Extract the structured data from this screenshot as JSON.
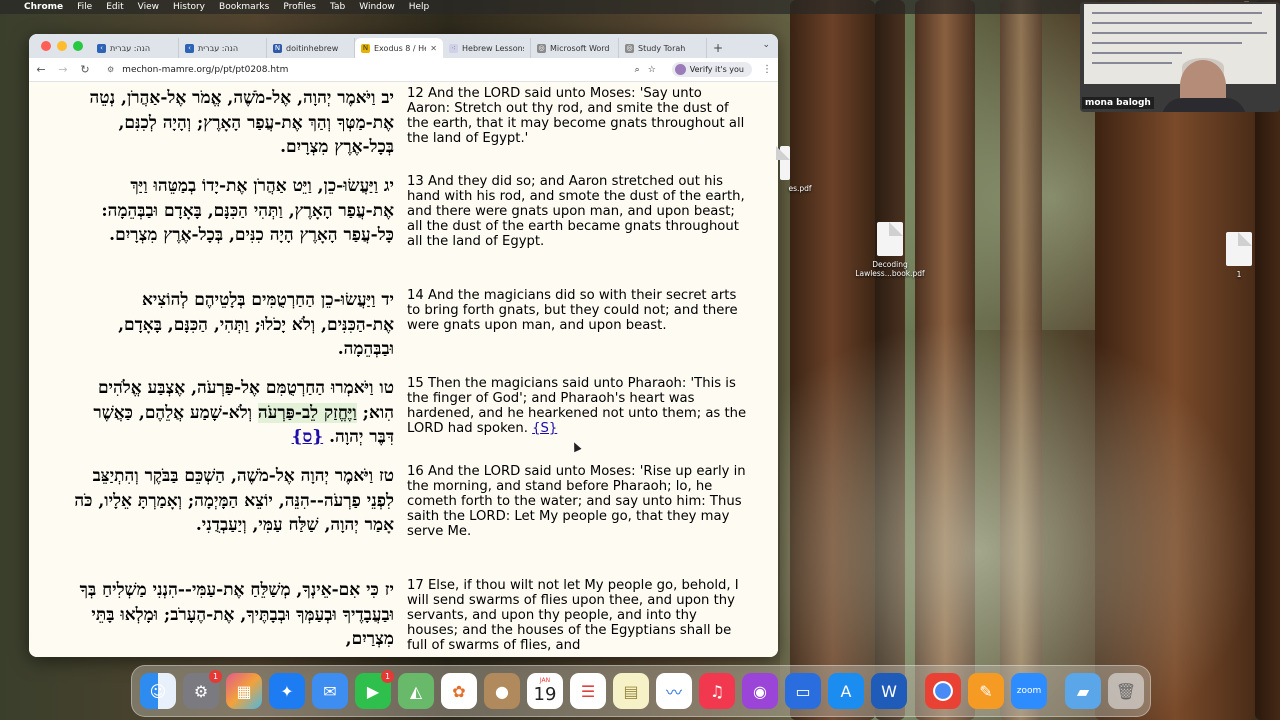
{
  "menubar": {
    "app_name": "Chrome",
    "items": [
      "File",
      "Edit",
      "View",
      "History",
      "Bookmarks",
      "Profiles",
      "Tab",
      "Window",
      "Help"
    ]
  },
  "browser": {
    "tabs": [
      {
        "label": "הנה: עברית",
        "icon": "bookmark-icon",
        "active": false
      },
      {
        "label": "הנה: עברית",
        "icon": "bookmark-icon",
        "active": false
      },
      {
        "label": "doitinhebrew",
        "icon": "n-icon",
        "active": false
      },
      {
        "label": "Exodus 8 / Hebrew",
        "icon": "bookmark-icon",
        "active": true
      },
      {
        "label": "Hebrew Lessons",
        "icon": "dots-icon",
        "active": false
      },
      {
        "label": "Microsoft Word",
        "icon": "globe-icon",
        "active": false
      },
      {
        "label": "Study Torah",
        "icon": "globe-icon",
        "active": false
      }
    ],
    "url": "mechon-mamre.org/p/pt/pt0208.htm",
    "verify_label": "Verify it's you"
  },
  "verses": [
    {
      "hebrew": "יב  וַיֹּאמֶר יְהוָה, אֶל-מֹשֶׁה, אֱמֹר אֶל-אַהֲרֹן, נְטֵה אֶת-מַטְּךָ וְהַךְ אֶת-עֲפַר הָאָרֶץ; וְהָיָה לְכִנִּם, בְּכָל-אֶרֶץ מִצְרָיִם.",
      "english": "12 And the LORD said unto Moses: 'Say unto Aaron: Stretch out thy rod, and smite the dust of the earth, that it may become gnats throughout all the land of Egypt.'"
    },
    {
      "hebrew": "יג  וַיַּעֲשׂוּ-כֵן, וַיֵּט אַהֲרֹן אֶת-יָדוֹ בְמַטֵּהוּ וַיַּךְ אֶת-עֲפַר הָאָרֶץ, וַתְּהִי הַכִּנָּם, בָּאָדָם וּבַבְּהֵמָה:  כָּל-עֲפַר הָאָרֶץ הָיָה כִנִּים, בְּכָל-אֶרֶץ מִצְרָיִם.",
      "english": "13 And they did so; and Aaron stretched out his hand with his rod, and smote the dust of the earth, and there were gnats upon man, and upon beast; all the dust of the earth became gnats throughout all the land of Egypt."
    },
    {
      "hebrew": "יד  וַיַּעֲשׂוּ-כֵן הַחַרְטֻמִּים בְּלָטֵיהֶם לְהוֹצִיא אֶת-הַכִּנִּים, וְלֹא יָכֹלוּ; וַתְּהִי, הַכִּנָּם, בָּאָדָם, וּבַבְּהֵמָה.",
      "english": "14 And the magicians did so with their secret arts to bring forth gnats, but they could not; and there were gnats upon man, and upon beast."
    },
    {
      "hebrew_pre": "טו  וַיֹּאמְרוּ הַחַרְטֻמִּם אֶל-פַּרְעֹה, אֶצְבַּע אֱלֹהִים הִוא; ",
      "hebrew_hl": "וַיֶּחֱזַק לֵב-פַּרְעֹה",
      "hebrew_post": " וְלֹא-שָׁמַע אֲלֵהֶם, כַּאֲשֶׁר דִּבֶּר יְהוָה.  ",
      "hebrew_link": "{ס}",
      "english": "15 Then the magicians said unto Pharaoh: 'This is the finger of God'; and Pharaoh's heart was hardened, and he hearkened not unto them; as the LORD had spoken. ",
      "english_link": "{S}"
    },
    {
      "hebrew": "טז  וַיֹּאמֶר יְהוָה אֶל-מֹשֶׁה, הַשְׁכֵּם בַּבֹּקֶר וְהִתְיַצֵּב לִפְנֵי פַרְעֹה--הִנֵּה, יוֹצֵא הַמָּיְמָה; וְאָמַרְתָּ אֵלָיו, כֹּה אָמַר יְהוָה, שַׁלַּח עַמִּי, וְיַעַבְדֻנִי.",
      "english": "16 And the LORD said unto Moses: 'Rise up early in the morning, and stand before Pharaoh; lo, he cometh forth to the water; and say unto him: Thus saith the LORD: Let My people go, that they may serve Me."
    },
    {
      "hebrew": "יז  כִּי אִם-אֵינְךָ, מְשַׁלֵּחַ אֶת-עַמִּי--הִנְנִי מַשְׁלִיחַ בְּךָ וּבַעֲבָדֶיךָ וּבְעַמְּךָ וּבְבָתֶּיךָ, אֶת-הֶעָרֹב; וּמָלְאוּ בָּתֵּי מִצְרַיִם,",
      "english": "17 Else, if thou wilt not let My people go, behold, I will send swarms of flies upon thee, and upon thy servants, and upon thy people, and into thy houses; and the houses of the Egyptians shall be full of swarms of flies, and"
    }
  ],
  "zoom_tile": {
    "participant_name": "mona balogh"
  },
  "desktop_files": [
    {
      "name": "es.pdf"
    },
    {
      "name": "Decoding Lawless...book.pdf"
    },
    {
      "name": "1"
    }
  ],
  "dock": {
    "calendar_month": "JAN",
    "calendar_day": "19",
    "badges": {
      "settings": "1",
      "facetime": "1"
    },
    "zoom_label": "zoom",
    "apps": [
      "finder-icon",
      "system-settings-icon",
      "launchpad-icon",
      "safari-icon",
      "mail-icon",
      "facetime-icon",
      "maps-icon",
      "photos-icon",
      "contacts-icon",
      "calendar-icon",
      "reminders-icon",
      "notes-icon",
      "freeform-icon",
      "music-icon",
      "podcasts-icon",
      "keynote-icon",
      "app-store-icon",
      "word-icon",
      "chrome-icon",
      "pages-icon",
      "zoom-icon",
      "downloads-folder-icon",
      "trash-icon"
    ]
  }
}
